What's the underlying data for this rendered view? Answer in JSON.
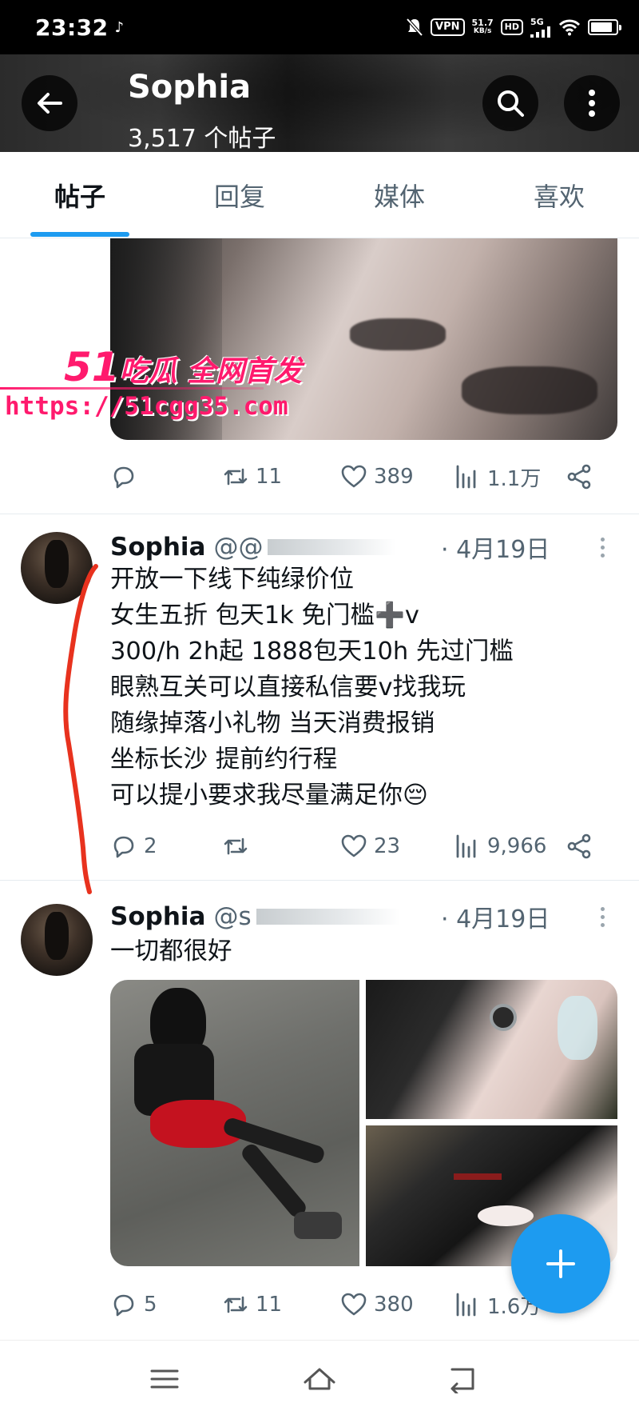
{
  "status_bar": {
    "time": "23:32",
    "vpn": "VPN",
    "net_speed_value": "51.7",
    "net_speed_unit": "KB/s",
    "hd": "HD",
    "network": "5G"
  },
  "header": {
    "name": "Sophia",
    "post_count": "3,517 个帖子"
  },
  "tabs": [
    {
      "label": "帖子",
      "active": true
    },
    {
      "label": "回复",
      "active": false
    },
    {
      "label": "媒体",
      "active": false
    },
    {
      "label": "喜欢",
      "active": false
    }
  ],
  "watermark": {
    "title_num": "51",
    "title_text": "吃瓜 全网首发",
    "url": "https://51cgg35.com"
  },
  "post0": {
    "actions": {
      "reply": "",
      "retweet": "11",
      "like": "389",
      "views": "1.1万"
    }
  },
  "post1": {
    "name": "Sophia",
    "handle": "@@",
    "date": "· 4月19日",
    "text": "开放一下线下纯绿价位\n女生五折 包天1k 免门槛➕v\n300/h 2h起 1888包天10h 先过门槛\n眼熟互关可以直接私信要v找我玩\n随缘掉落小礼物 当天消费报销\n坐标长沙 提前约行程\n可以提小要求我尽量满足你😔",
    "actions": {
      "reply": "2",
      "retweet": "",
      "like": "23",
      "views": "9,966"
    }
  },
  "post2": {
    "name": "Sophia",
    "handle": "@s",
    "date": "· 4月19日",
    "text": "一切都很好",
    "actions": {
      "reply": "5",
      "retweet": "11",
      "like": "380",
      "views": "1.6万"
    }
  },
  "icons": {
    "back": "arrow-left-icon",
    "search": "search-icon",
    "more": "more-vertical-icon",
    "reply": "reply-icon",
    "retweet": "retweet-icon",
    "like": "heart-icon",
    "views": "views-icon",
    "share": "share-icon",
    "compose": "plus-icon"
  },
  "colors": {
    "accent": "#1d9bf0",
    "text": "#0f1419",
    "muted": "#536471",
    "watermark": "#ff1a6d",
    "annotation": "#e8321e"
  }
}
